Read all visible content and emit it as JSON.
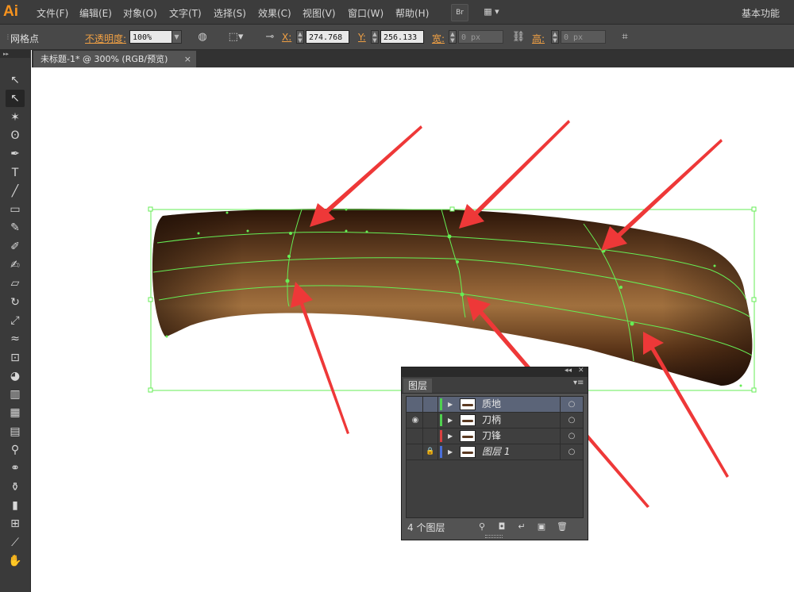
{
  "app": {
    "logo": "Ai",
    "workspace": "基本功能"
  },
  "menu": [
    {
      "id": "file",
      "label": "文件(F)"
    },
    {
      "id": "edit",
      "label": "编辑(E)"
    },
    {
      "id": "object",
      "label": "对象(O)"
    },
    {
      "id": "type",
      "label": "文字(T)"
    },
    {
      "id": "select",
      "label": "选择(S)"
    },
    {
      "id": "effect",
      "label": "效果(C)"
    },
    {
      "id": "view",
      "label": "视图(V)"
    },
    {
      "id": "window",
      "label": "窗口(W)"
    },
    {
      "id": "help",
      "label": "帮助(H)"
    }
  ],
  "menubar_buttons": {
    "bridge": "Br",
    "arrange": "▦ ▾"
  },
  "control_bar": {
    "selection_label": "网格点",
    "opacity_label": "不透明度:",
    "opacity_value": "100%",
    "x_label": "X:",
    "x_value": "274.768",
    "y_label": "Y:",
    "y_value": "256.133",
    "width_label": "宽:",
    "width_value": "0 px",
    "height_label": "高:",
    "height_value": "0 px"
  },
  "document_tab": {
    "title": "未标题-1* @ 300% (RGB/预览)",
    "close": "×"
  },
  "tools": [
    {
      "name": "selection-tool",
      "glyph": "↖"
    },
    {
      "name": "direct-selection-tool",
      "glyph": "↖",
      "active": true
    },
    {
      "name": "magic-wand-tool",
      "glyph": "✶"
    },
    {
      "name": "lasso-tool",
      "glyph": "ʘ"
    },
    {
      "name": "pen-tool",
      "glyph": "✒"
    },
    {
      "name": "type-tool",
      "glyph": "T"
    },
    {
      "name": "line-tool",
      "glyph": "╱"
    },
    {
      "name": "rectangle-tool",
      "glyph": "▭"
    },
    {
      "name": "paintbrush-tool",
      "glyph": "✎"
    },
    {
      "name": "pencil-tool",
      "glyph": "✐"
    },
    {
      "name": "blob-brush-tool",
      "glyph": "✍"
    },
    {
      "name": "eraser-tool",
      "glyph": "▱"
    },
    {
      "name": "rotate-tool",
      "glyph": "↻"
    },
    {
      "name": "scale-tool",
      "glyph": "⤢"
    },
    {
      "name": "warp-tool",
      "glyph": "≈"
    },
    {
      "name": "free-transform-tool",
      "glyph": "⊡"
    },
    {
      "name": "shape-builder-tool",
      "glyph": "◕"
    },
    {
      "name": "perspective-grid-tool",
      "glyph": "▥"
    },
    {
      "name": "mesh-tool",
      "glyph": "▦"
    },
    {
      "name": "gradient-tool",
      "glyph": "▤"
    },
    {
      "name": "eyedropper-tool",
      "glyph": "⚲"
    },
    {
      "name": "blend-tool",
      "glyph": "⚭"
    },
    {
      "name": "symbol-sprayer-tool",
      "glyph": "⚱"
    },
    {
      "name": "column-graph-tool",
      "glyph": "▮"
    },
    {
      "name": "artboard-tool",
      "glyph": "⊞"
    },
    {
      "name": "slice-tool",
      "glyph": "⟋"
    },
    {
      "name": "hand-tool",
      "glyph": "✋"
    }
  ],
  "layers_panel": {
    "tab": "图层",
    "collapse": "◂◂",
    "close": "✕",
    "menu": "▾≡",
    "layers": [
      {
        "name": "质地",
        "color": "#4fd04f",
        "visible": false,
        "locked": false,
        "selected": true,
        "italic": false
      },
      {
        "name": "刀柄",
        "color": "#4fd04f",
        "visible": true,
        "locked": false,
        "selected": false,
        "italic": false
      },
      {
        "name": "刀锋",
        "color": "#d84040",
        "visible": false,
        "locked": false,
        "selected": false,
        "italic": false
      },
      {
        "name": "图层 1",
        "color": "#4a6ed8",
        "visible": false,
        "locked": true,
        "selected": false,
        "italic": true
      }
    ],
    "layer_count": "4 个图层",
    "eye_glyph": "◉",
    "lock_glyph": "🔒",
    "expand_glyph": "▶",
    "target_glyph": "○"
  },
  "colors": {
    "mesh_line": "#66ee55",
    "arrow": "#ee3838",
    "shape_dark": "#2e170c",
    "shape_highlight": "#a0703e"
  }
}
